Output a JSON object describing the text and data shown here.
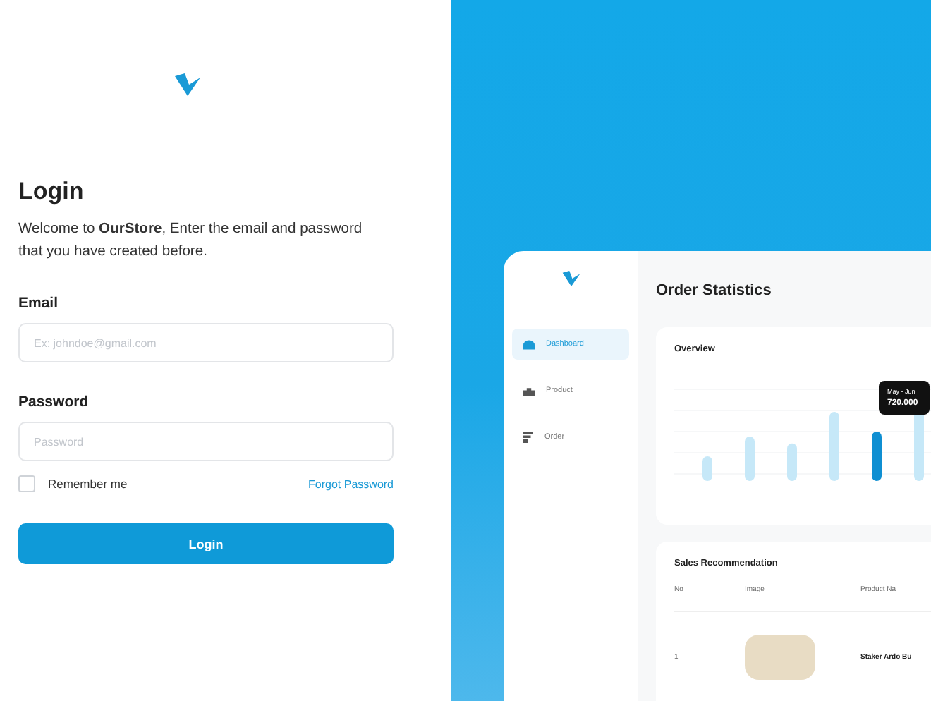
{
  "login": {
    "title": "Login",
    "description": "Welcome to **OurStore**, Enter the email and password that you have created before.",
    "email": {
      "label": "Email",
      "placeholder": "Ex: johndoe@gmail.com"
    },
    "password": {
      "label": "Password",
      "placeholder": "Password"
    },
    "remember": {
      "label": "Remember me",
      "checked": false
    },
    "forgot_link": "Forgot Password",
    "submit": "Login"
  },
  "dashboard": {
    "sidebar": {
      "items": [
        {
          "label": "Dashboard",
          "selected": true
        },
        {
          "label": "Product",
          "selected": false
        },
        {
          "label": "Order",
          "selected": false
        }
      ]
    },
    "title": "Order Statistics",
    "overview": {
      "title": "Overview",
      "tooltip": {
        "period": "May - Jun",
        "value": "720.000"
      }
    },
    "sales": {
      "title": "Sales Recommendation",
      "columns": [
        "No",
        "Image",
        "Product Na"
      ],
      "rows": [
        {
          "no": "1",
          "product": "Staker Ardo Bu"
        }
      ]
    }
  }
}
